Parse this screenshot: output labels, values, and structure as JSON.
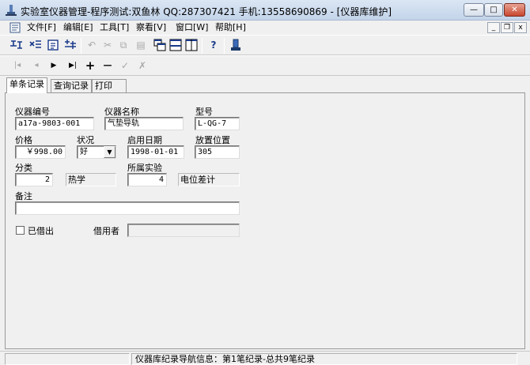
{
  "window": {
    "title": "实验室仪器管理-程序测试:双鱼林  QQ:287307421  手机:13558690869 - [仪器库维护]",
    "minimize_glyph": "—",
    "maximize_glyph": "□",
    "close_glyph": "✕"
  },
  "menu": {
    "items": [
      "文件[F]",
      "编辑[E]",
      "工具[T]",
      "察看[V]",
      "窗口[W]",
      "帮助[H]"
    ],
    "mdi_minimize": "_",
    "mdi_restore": "❐",
    "mdi_close": "x"
  },
  "toolbar": {
    "undo_glyph": "↶",
    "cut_glyph": "✂",
    "copy_glyph": "⧉",
    "paste_glyph": "▤",
    "help_glyph": "?",
    "first_glyph": "|◂",
    "prev_glyph": "◂",
    "next_glyph": "▶",
    "last_glyph": "▶|",
    "add_glyph": "+",
    "delete_glyph": "—",
    "confirm_glyph": "✓",
    "cancel_glyph": "✗"
  },
  "tabs": [
    "单条记录",
    "查询记录",
    "打印"
  ],
  "form": {
    "instrument_no": {
      "label": "仪器编号",
      "value": "a17a-9803-001"
    },
    "instrument_name": {
      "label": "仪器名称",
      "value": "气垫导轨"
    },
    "model": {
      "label": "型号",
      "value": "L-QG-7"
    },
    "price": {
      "label": "价格",
      "value": "￥998.00"
    },
    "condition": {
      "label": "状况",
      "value": "好"
    },
    "start_date": {
      "label": "启用日期",
      "value": "1998-01-01"
    },
    "location": {
      "label": "放置位置",
      "value": "305"
    },
    "category": {
      "label": "分类",
      "code": "2",
      "name": "热学"
    },
    "experiment": {
      "label": "所属实验",
      "code": "4",
      "name": "电位差计"
    },
    "remarks": {
      "label": "备注",
      "value": ""
    },
    "borrowed": {
      "label": "已借出",
      "checked": false
    },
    "borrower": {
      "label": "借用者",
      "value": ""
    }
  },
  "status": {
    "message": "仪器库纪录导航信息：第1笔纪录-总共9笔纪录"
  }
}
